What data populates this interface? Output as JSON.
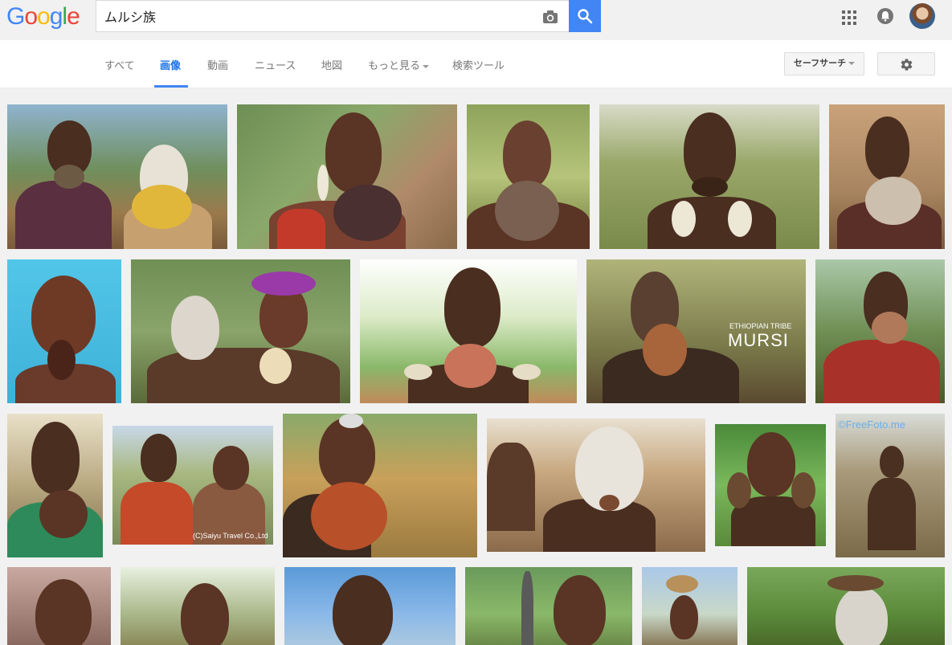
{
  "logo": {
    "text": "Google"
  },
  "search": {
    "query": "ムルシ族"
  },
  "nav": {
    "tabs": [
      {
        "label": "すべて"
      },
      {
        "label": "画像"
      },
      {
        "label": "動画"
      },
      {
        "label": "ニュース"
      },
      {
        "label": "地図"
      },
      {
        "label": "もっと見る"
      },
      {
        "label": "検索ツール"
      }
    ],
    "active_tab": "画像",
    "safesearch_label": "セーフサーチ"
  },
  "images": {
    "watermarks": {
      "ethiopian_tribe": "ETHIOPIAN TRIBE",
      "mursi": "MURSI",
      "saiyu": "(C)Saiyu Travel Co.,Ltd",
      "freefoto": "©FreeFoto.me"
    }
  },
  "colors": {
    "accent": "#4285f4",
    "active_tab": "#1a73e8",
    "background": "#f1f1f1"
  }
}
